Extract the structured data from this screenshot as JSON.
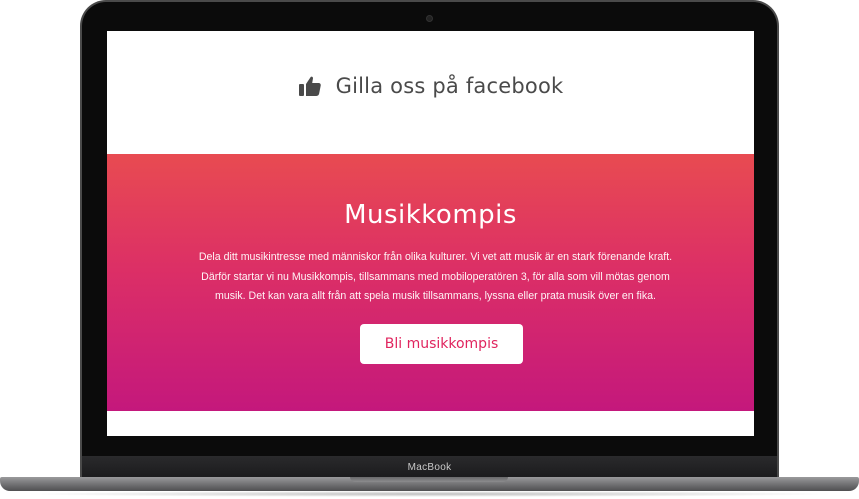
{
  "device": {
    "brand_label": "MacBook"
  },
  "facebook": {
    "icon": "thumbs-up-icon",
    "link_text": "Gilla oss på facebook"
  },
  "hero": {
    "title": "Musikkompis",
    "body": "Dela ditt musikintresse med människor från olika kulturer. Vi vet att musik är en stark förenande kraft. Därför startar vi nu Musikkompis, tillsammans med mobiloperatören 3, för alla som vill mötas genom musik. Det kan vara allt från att spela musik tillsammans, lyssna eller prata musik över en fika.",
    "cta_label": "Bli musikkompis"
  },
  "colors": {
    "gradient_top": "#e84b51",
    "gradient_bottom": "#c4187c",
    "cta_text": "#e0245e",
    "facebook_text": "#4a4a4a"
  }
}
